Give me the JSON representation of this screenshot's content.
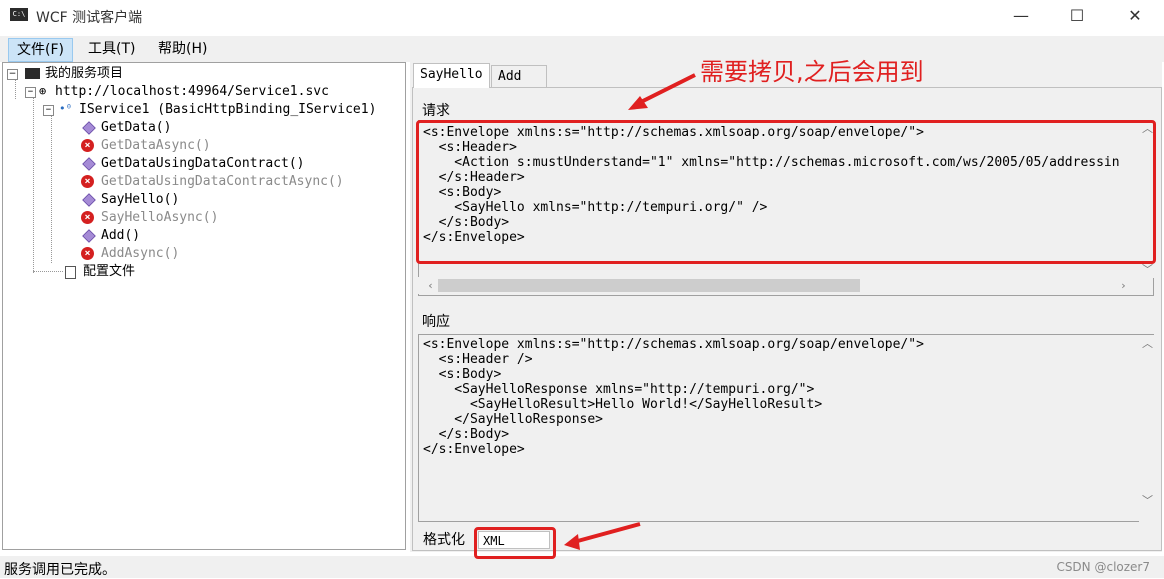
{
  "window": {
    "title": "WCF 测试客户端",
    "icon_text": "C:\\",
    "minimize_glyph": "—",
    "maximize_glyph": "☐",
    "close_glyph": "✕"
  },
  "menu": {
    "items": [
      "文件(F)",
      "工具(T)",
      "帮助(H)"
    ]
  },
  "tree": {
    "root": "我的服务项目",
    "endpoint": "http://localhost:49964/Service1.svc",
    "contract": "IService1 (BasicHttpBinding_IService1)",
    "operations": [
      {
        "label": "GetData()",
        "enabled": true
      },
      {
        "label": "GetDataAsync()",
        "enabled": false
      },
      {
        "label": "GetDataUsingDataContract()",
        "enabled": true
      },
      {
        "label": "GetDataUsingDataContractAsync()",
        "enabled": false
      },
      {
        "label": "SayHello()",
        "enabled": true
      },
      {
        "label": "SayHelloAsync()",
        "enabled": false
      },
      {
        "label": "Add()",
        "enabled": true
      },
      {
        "label": "AddAsync()",
        "enabled": false
      }
    ],
    "config": "配置文件"
  },
  "tabs": [
    "SayHello",
    "Add"
  ],
  "request": {
    "label": "请求",
    "xml": "<s:Envelope xmlns:s=\"http://schemas.xmlsoap.org/soap/envelope/\">\n  <s:Header>\n    <Action s:mustUnderstand=\"1\" xmlns=\"http://schemas.microsoft.com/ws/2005/05/addressin\n  </s:Header>\n  <s:Body>\n    <SayHello xmlns=\"http://tempuri.org/\" />\n  </s:Body>\n</s:Envelope>"
  },
  "response": {
    "label": "响应",
    "xml": "<s:Envelope xmlns:s=\"http://schemas.xmlsoap.org/soap/envelope/\">\n  <s:Header />\n  <s:Body>\n    <SayHelloResponse xmlns=\"http://tempuri.org/\">\n      <SayHelloResult>Hello World!</SayHelloResult>\n    </SayHelloResponse>\n  </s:Body>\n</s:Envelope>"
  },
  "format": {
    "label": "格式化",
    "selected": "XML"
  },
  "status": {
    "text": "服务调用已完成。"
  },
  "watermark": "CSDN @clozer7",
  "annotation": {
    "text": "需要拷贝,之后会用到",
    "color": "#e02020"
  }
}
